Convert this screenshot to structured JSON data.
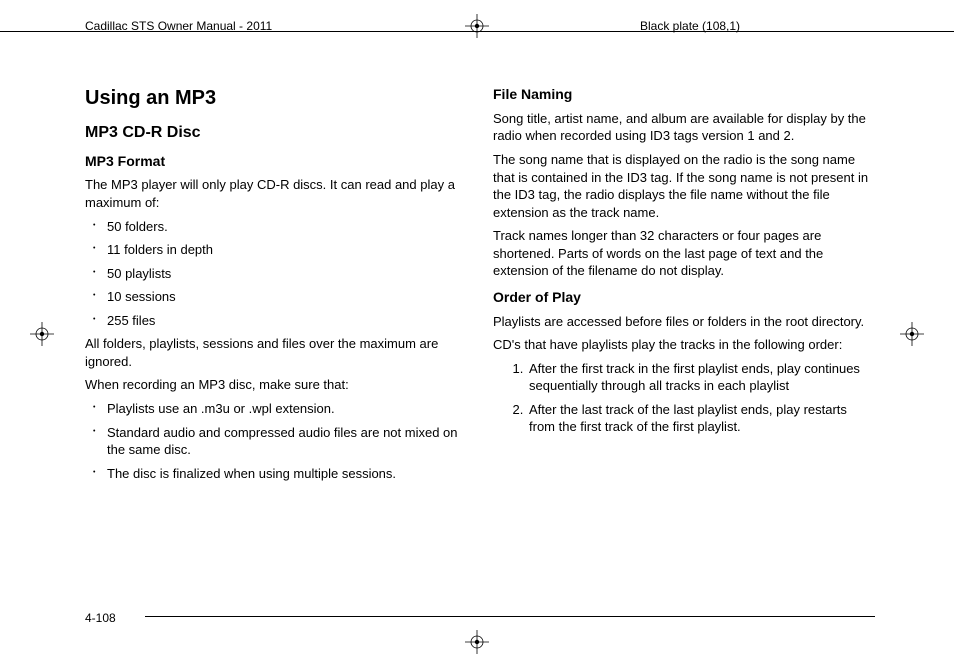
{
  "header": {
    "left": "Cadillac STS Owner Manual - 2011",
    "right": "Black plate (108,1)"
  },
  "left_col": {
    "h1": "Using an MP3",
    "h2": "MP3 CD-R Disc",
    "h3": "MP3 Format",
    "intro": "The MP3 player will only play CD-R discs. It can read and play a maximum of:",
    "limits": [
      "50 folders.",
      "11 folders in depth",
      "50 playlists",
      "10 sessions",
      "255 files"
    ],
    "after_limits": "All folders, playlists, sessions and files over the maximum are ignored.",
    "recording_intro": "When recording an MP3 disc, make sure that:",
    "recording_list": [
      "Playlists use an .m3u or .wpl extension.",
      "Standard audio and compressed audio files are not mixed on the same disc.",
      "The disc is finalized when using multiple sessions."
    ]
  },
  "right_col": {
    "file_naming_h": "File Naming",
    "fn_p1": "Song title, artist name, and album are available for display by the radio when recorded using ID3 tags version 1 and 2.",
    "fn_p2": "The song name that is displayed on the radio is the song name that is contained in the ID3 tag. If the song name is not present in the ID3 tag, the radio displays the file name without the file extension as the track name.",
    "fn_p3": "Track names longer than 32 characters or four pages are shortened. Parts of words on the last page of text and the extension of the filename do not display.",
    "order_h": "Order of Play",
    "op_p1": "Playlists are accessed before files or folders in the root directory.",
    "op_p2": "CD's that have playlists play the tracks in the following order:",
    "op_list": [
      "After the first track in the first playlist ends, play continues sequentially through all tracks in each playlist",
      " After the last track of the last playlist ends, play restarts from the first track of the first playlist."
    ]
  },
  "footer": {
    "page": "4-108"
  }
}
